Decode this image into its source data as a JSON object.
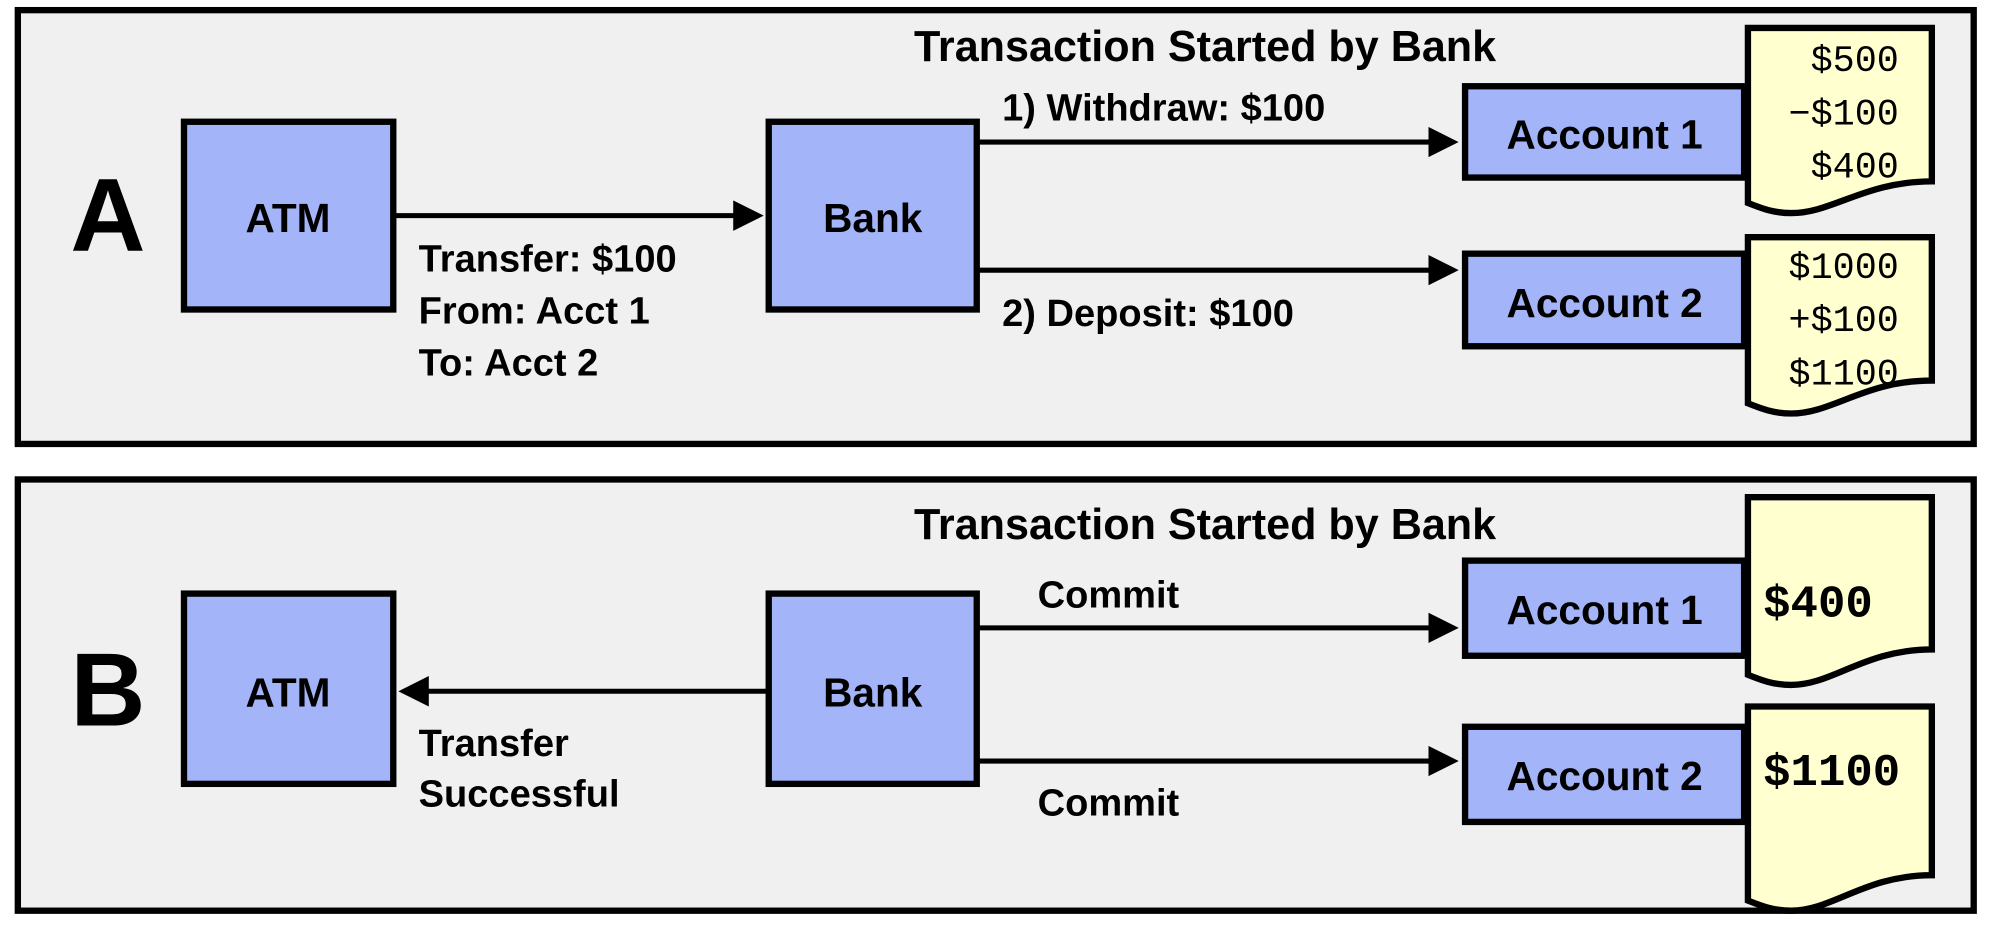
{
  "colors": {
    "panel": "#f0f0f0",
    "node": "#a4b4f8",
    "ledger": "#ffffd0",
    "stroke": "#000000"
  },
  "panel_a": {
    "label": "A",
    "title": "Transaction Started by Bank",
    "atm": "ATM",
    "bank": "Bank",
    "request": [
      "Transfer: $100",
      "From: Acct 1",
      "To: Acct 2"
    ],
    "withdraw": "1) Withdraw: $100",
    "deposit": "2) Deposit: $100",
    "account1": "Account 1",
    "account2": "Account 2",
    "ledger1": [
      "$500",
      "−$100",
      "$400"
    ],
    "ledger2": [
      "$1000",
      "+$100",
      "$1100"
    ]
  },
  "panel_b": {
    "label": "B",
    "title": "Transaction Started by Bank",
    "atm": "ATM",
    "bank": "Bank",
    "response": [
      "Transfer",
      "Successful"
    ],
    "commit1": "Commit",
    "commit2": "Commit",
    "account1": "Account 1",
    "account2": "Account 2",
    "ledger1": "$400",
    "ledger2": "$1100"
  }
}
